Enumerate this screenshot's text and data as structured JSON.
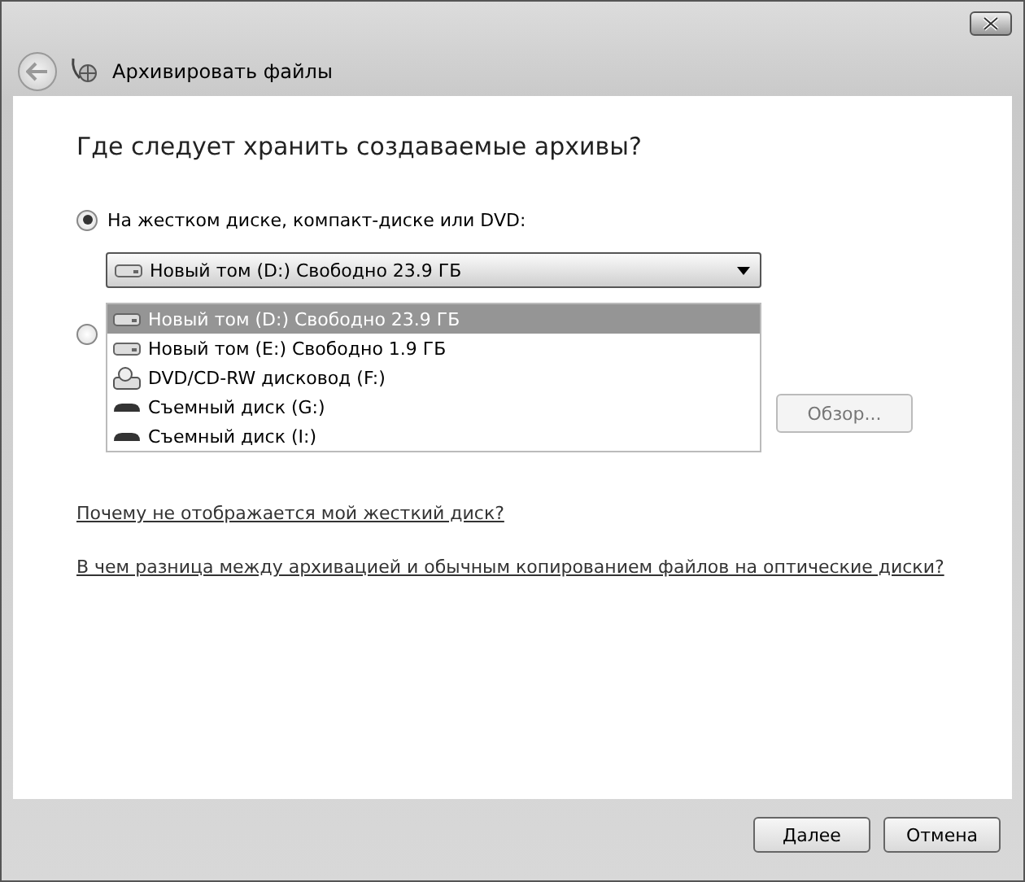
{
  "window": {
    "title": "Архивировать файлы"
  },
  "heading": "Где следует хранить создаваемые архивы?",
  "options": [
    {
      "label": "На жестком диске, компакт-диске или DVD:",
      "selected": true
    },
    {
      "selected": false
    }
  ],
  "drive_combo": {
    "value": "Новый том (D:)  Свободно 23.9 ГБ",
    "expanded": true,
    "items": [
      {
        "label": "Новый том (D:)  Свободно 23.9 ГБ",
        "kind": "hdd",
        "selected": true
      },
      {
        "label": "Новый том (E:)  Свободно 1.9 ГБ",
        "kind": "hdd",
        "selected": false
      },
      {
        "label": "DVD/CD-RW дисковод (F:)",
        "kind": "dvd",
        "selected": false
      },
      {
        "label": "Съемный диск (G:)",
        "kind": "removable",
        "selected": false
      },
      {
        "label": "Съемный диск (I:)",
        "kind": "removable",
        "selected": false
      }
    ]
  },
  "browse_button": {
    "label": "Обзор...",
    "disabled": true
  },
  "links": [
    "Почему не отображается мой жесткий диск?",
    "В чем разница между архивацией и обычным копированием файлов на оптические диски?"
  ],
  "buttons": [
    "Далее",
    "Отмена"
  ]
}
